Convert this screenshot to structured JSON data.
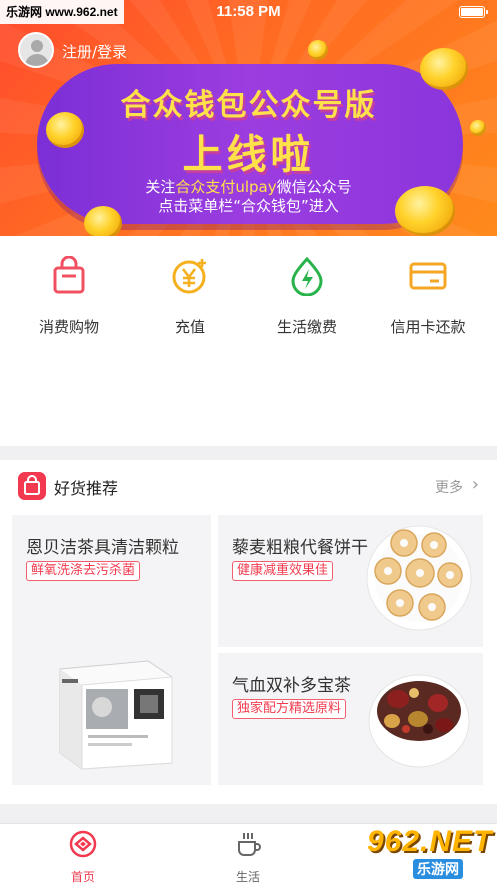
{
  "watermark": {
    "top_left": "乐游网 www.962.net",
    "bottom_right_big": "962.NET",
    "bottom_right_small": "乐游网"
  },
  "status_bar": {
    "time": "11:58 PM"
  },
  "user": {
    "login_label": "注册/登录"
  },
  "banner": {
    "title_line1": "合众钱包公众号版",
    "title_line2": "上线啦",
    "sub_prefix": "关注",
    "sub_highlight": "合众支付ulpay",
    "sub_suffix": "微信公众号",
    "sub_line2": "点击菜单栏“合众钱包”进入",
    "colors": {
      "accent": "#ffe14a",
      "pill": "#8a35dc",
      "bg": "#ff6a22"
    }
  },
  "quick_menu": [
    {
      "label": "消费购物",
      "icon": "shopping-bag-icon",
      "color": "#f0505f"
    },
    {
      "label": "充值",
      "icon": "yuan-plus-icon",
      "color": "#f5b020"
    },
    {
      "label": "生活缴费",
      "icon": "leaf-bolt-icon",
      "color": "#27b34a"
    },
    {
      "label": "信用卡还款",
      "icon": "credit-card-icon",
      "color": "#f5a623"
    }
  ],
  "recommend": {
    "title": "好货推荐",
    "more": "更多",
    "products": [
      {
        "name": "恩贝洁茶具清洁颗粒",
        "tag": "鲜氧洗涤去污杀菌"
      },
      {
        "name": "藜麦粗粮代餐饼干",
        "tag": "健康减重效果佳"
      },
      {
        "name": "气血双补多宝茶",
        "tag": "独家配方精选原料"
      }
    ]
  },
  "tabbar": {
    "tabs": [
      {
        "label": "首页",
        "icon": "home-icon",
        "active": true
      },
      {
        "label": "生活",
        "icon": "coffee-cup-icon",
        "active": false
      }
    ],
    "active_color": "#f2394f",
    "inactive_color": "#666666"
  }
}
